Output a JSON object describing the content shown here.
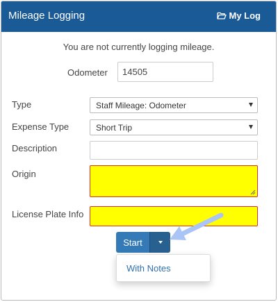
{
  "header": {
    "title": "Mileage Logging",
    "mylog_label": "My Log",
    "mylog_icon": "folder-open-icon",
    "color": "#1a5a96"
  },
  "status_text": "You are not currently logging mileage.",
  "odometer": {
    "label": "Odometer",
    "value": "14505"
  },
  "type": {
    "label": "Type",
    "selected": "Staff Mileage: Odometer"
  },
  "expense_type": {
    "label": "Expense Type",
    "selected": "Short Trip"
  },
  "description": {
    "label": "Description",
    "value": ""
  },
  "origin": {
    "label": "Origin",
    "value": "",
    "highlight": "#ffff00"
  },
  "license_plate": {
    "label": "License Plate Info",
    "value": "",
    "highlight": "#ffff00"
  },
  "actions": {
    "start_label": "Start",
    "dropdown_items": [
      "With Notes"
    ],
    "button_color": "#337ab7"
  },
  "annotation_arrow_color": "#a9c4f5"
}
